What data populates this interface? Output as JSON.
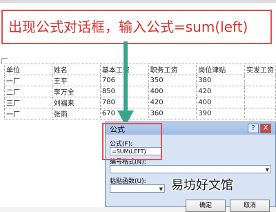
{
  "caption": {
    "text": "出现公式对话框，输入公式=sum(left)"
  },
  "table": {
    "rows": [
      [
        "单位",
        "姓名",
        "基本工资",
        "职务工资",
        "岗位津贴",
        "实发工资"
      ],
      [
        "一厂",
        "王平",
        "706",
        "350",
        "380",
        ""
      ],
      [
        "二厂",
        "李万全",
        "850",
        "400",
        "420",
        ""
      ],
      [
        "三厂",
        "刘福来",
        "780",
        "420",
        "400",
        ""
      ],
      [
        "一厂",
        "张雨",
        "670",
        "360",
        "390",
        ""
      ]
    ]
  },
  "dialog": {
    "title": "公式",
    "help_label": "?",
    "close_label": "X",
    "formula_label": "公式(F):",
    "formula_value": "=SUM(LEFT)",
    "number_format_label": "编号格式(N):",
    "number_format_value": "",
    "paste_function_label": "粘贴函数(U):",
    "paste_function_value": "",
    "ok_label": "确定",
    "cancel_label": "取消"
  },
  "watermark": {
    "text": "易坊好文馆"
  },
  "colors": {
    "caption_red": "#d8302b",
    "highlight_box": "#e05252",
    "arrow_teal": "#3aa58f",
    "dialog_bg": "#d8e4f4"
  }
}
